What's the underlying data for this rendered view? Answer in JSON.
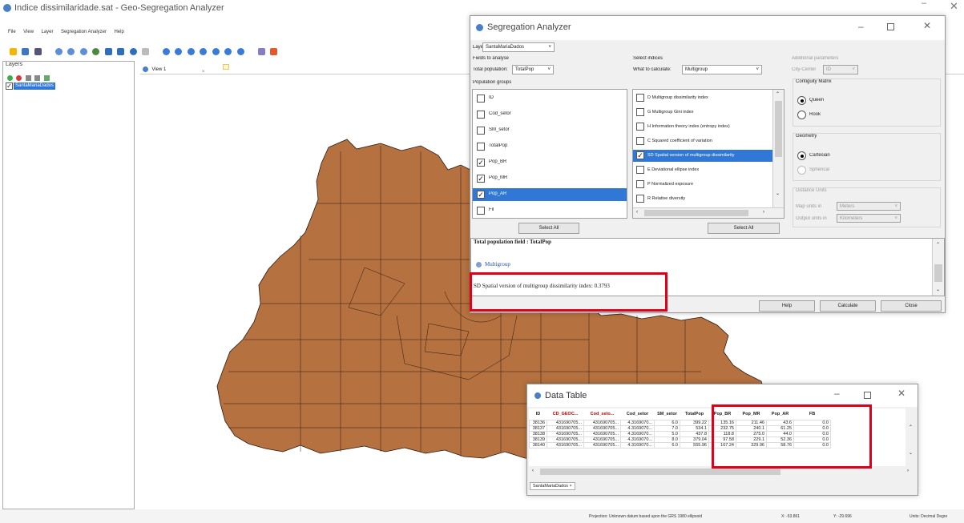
{
  "app": {
    "title": "Indice dissimilaridade.sat - Geo-Segregation Analyzer",
    "menu": [
      "File",
      "View",
      "Layer",
      "Segregation Analyzer",
      "Help"
    ]
  },
  "layers_panel": {
    "title": "Layers",
    "layer_name": "SantaMariaDados"
  },
  "view": {
    "tab_label": "View 1",
    "fill_color": "#b5713f"
  },
  "status_bar": {
    "projection": "Projection: Unknown datum based upon the GRS 1980 ellipsoid",
    "x": "X: -53.861",
    "y": "Y: -29.696",
    "units": "Units: Decimal Degre"
  },
  "seg_analyzer": {
    "title": "Segregation Analyzer",
    "layer_label": "Layer",
    "layer_value": "SantaMariaDados",
    "fields": {
      "header": "Fields to analyse",
      "total_label": "Total population:",
      "total_value": "TotalPop",
      "groups_header": "Population groups",
      "items": [
        {
          "label": "ID",
          "checked": ""
        },
        {
          "label": "Cod_setor",
          "checked": ""
        },
        {
          "label": "SM_setor",
          "checked": ""
        },
        {
          "label": "TotalPop",
          "checked": ""
        },
        {
          "label": "Pop_BR",
          "checked": "✓"
        },
        {
          "label": "Pop_MR",
          "checked": "✓"
        },
        {
          "label": "Pop_AR",
          "checked": "✓"
        },
        {
          "label": "Fil",
          "checked": ""
        }
      ],
      "select_all": "Select All"
    },
    "indices": {
      "header": "Select indices",
      "what_label": "What to calculate:",
      "what_value": "Multigroup",
      "items": [
        {
          "label": "D Multigroup dissimilarity index",
          "checked": ""
        },
        {
          "label": "G Multigroup Gini index",
          "checked": ""
        },
        {
          "label": "H Information theory index (entropy index)",
          "checked": ""
        },
        {
          "label": "C Squared coefficient of variation",
          "checked": ""
        },
        {
          "label": "SD Spatial version of multigroup dissimilarity",
          "checked": "✓"
        },
        {
          "label": "E Deviational ellipse index",
          "checked": ""
        },
        {
          "label": "P Normalized exposure",
          "checked": ""
        },
        {
          "label": "R Relative diversity",
          "checked": ""
        }
      ],
      "select_all": "Select All"
    },
    "params": {
      "header": "Additional parameters",
      "city_center_label": "City-Center",
      "city_center_value": "ID",
      "contiguity_title": "Contiguity Matrix",
      "queen": "Queen",
      "rook": "Rook",
      "geometry_title": "Geometry",
      "cartesian": "Cartesian",
      "spherical": "Spherical",
      "distance_title": "Distance Units",
      "map_units_label": "Map units in",
      "map_units_value": "Meters",
      "output_units_label": "Output units in",
      "output_units_value": "Kilometers"
    },
    "output": {
      "line1": "Total population field : TotalPop",
      "section": "Multigroup",
      "result": "SD Spatial version of multigroup dissimilarity index: 0.3793"
    },
    "buttons": {
      "help": "Help",
      "calculate": "Calculate",
      "close": "Close"
    }
  },
  "data_table": {
    "title": "Data Table",
    "columns": [
      "ID",
      "CD_GEOC...",
      "Cod_seto...",
      "Cod_setor",
      "SM_setor",
      "TotalPop",
      "Pop_BR",
      "Pop_MR",
      "Pop_AR",
      "FB"
    ],
    "rows": [
      [
        "38136",
        "431690705...",
        "431690705...",
        "4.3169070...",
        "6.0",
        "399.22",
        "135.16",
        "211.46",
        "43.6",
        "0.0"
      ],
      [
        "38137",
        "431690705...",
        "431690705...",
        "4.3169070...",
        "7.0",
        "534.1",
        "232.75",
        "240.1",
        "61.25",
        "0.0"
      ],
      [
        "38138",
        "431690705...",
        "431690705...",
        "4.3169070...",
        "5.0",
        "437.8",
        "118.8",
        "275.0",
        "44.0",
        "0.0"
      ],
      [
        "38139",
        "431690705...",
        "431690705...",
        "4.3169070...",
        "8.0",
        "379.04",
        "97.58",
        "229.1",
        "52.36",
        "0.0"
      ],
      [
        "38140",
        "431690705...",
        "431690705...",
        "4.3169070...",
        "6.0",
        "555.96",
        "167.24",
        "329.96",
        "58.76",
        "0.0"
      ]
    ],
    "tab_label": "SantaMariaDados"
  },
  "colors": {
    "highlight": "#e0001a",
    "selection": "#3178d6",
    "map_fill": "#b5713f"
  }
}
